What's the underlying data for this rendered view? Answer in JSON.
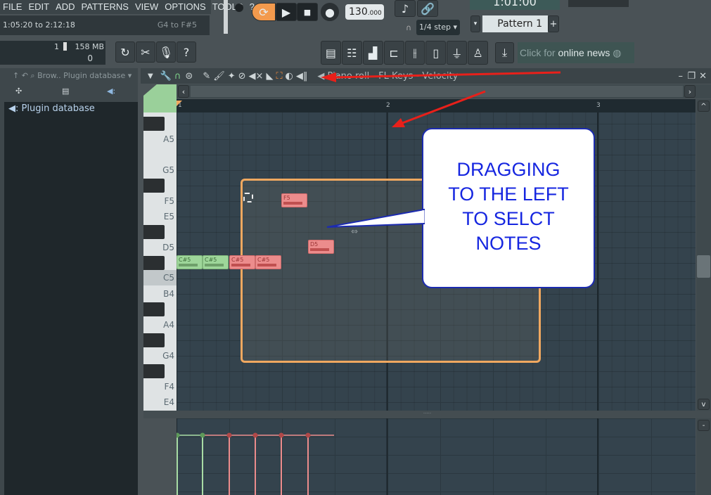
{
  "menu": [
    "FILE",
    "EDIT",
    "ADD",
    "PATTERNS",
    "VIEW",
    "OPTIONS",
    "TOOLS",
    "?"
  ],
  "hint": {
    "left": "1:05:20 to 2:12:18",
    "right": "G4 to F#5"
  },
  "transport": {
    "tempo": "130",
    "tempo_dec": ".000",
    "time": "1:01:00",
    "snap": "1/4 step",
    "pattern": "Pattern 1"
  },
  "meter": {
    "cpu": "1",
    "ram": "158 MB",
    "poly": "0"
  },
  "news": {
    "prefix": "Click for ",
    "main": "online news"
  },
  "browser": {
    "title": "Brow.. Plugin database",
    "item": "Plugin database"
  },
  "pianoroll": {
    "title": "Piano roll - FL Keys - Velocity",
    "bars": [
      "1",
      "2",
      "3"
    ],
    "keys": [
      "A5",
      "G5",
      "F5",
      "E5",
      "D5",
      "C5",
      "B4",
      "A4",
      "G4",
      "F4",
      "E4"
    ],
    "notes": [
      {
        "label": "C#5",
        "color": "green"
      },
      {
        "label": "C#5",
        "color": "green"
      },
      {
        "label": "C#5",
        "color": "red"
      },
      {
        "label": "C#5",
        "color": "red"
      },
      {
        "label": "F5",
        "color": "red"
      },
      {
        "label": "D5",
        "color": "red"
      }
    ]
  },
  "annotation": {
    "lines": [
      "DRAGGING",
      "TO THE LEFT",
      "TO SELCT",
      "NOTES"
    ],
    "text_color": "#1626e0",
    "arrow_color": "#e8201a"
  },
  "colors": {
    "selection": "#f0a860",
    "selected_note": "#ec8c8c",
    "note": "#9ed69a"
  }
}
